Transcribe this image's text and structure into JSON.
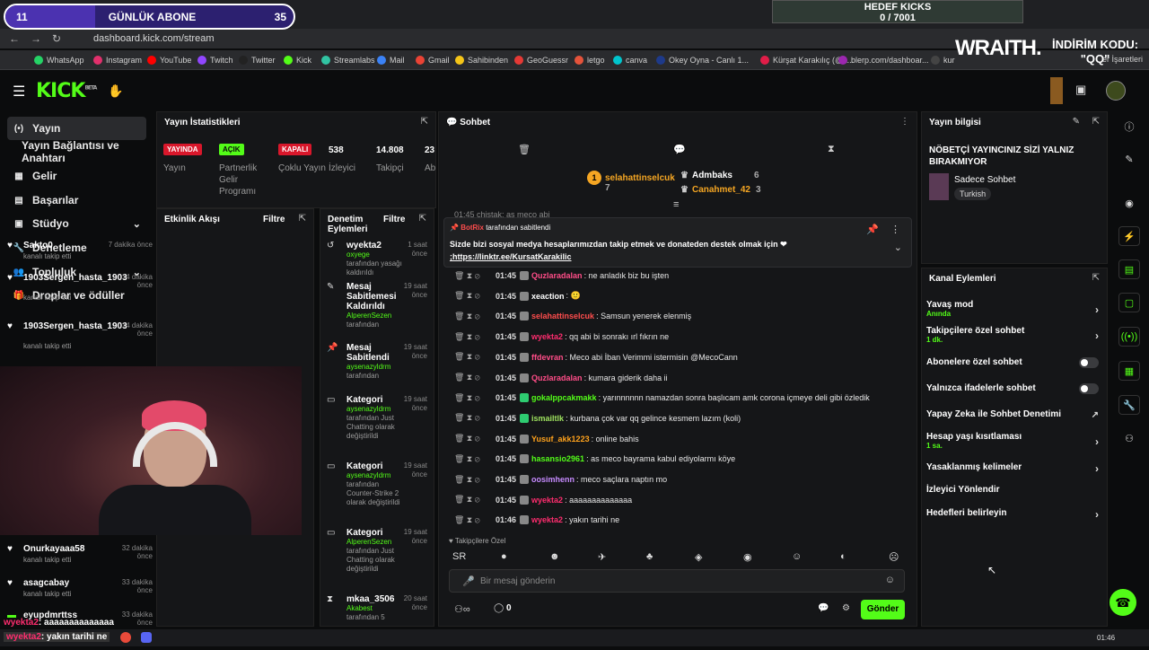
{
  "overlay": {
    "gunluk": {
      "left": "11",
      "title": "GÜNLÜK ABONE",
      "right": "35",
      "progress": 0.31
    },
    "hedef": {
      "title": "HEDEF KICKS",
      "value": "0 / 7001"
    },
    "wraith": "WRAITH.",
    "indirim_line1": "İNDİRİM KODU:",
    "indirim_line2": "\"QQ\""
  },
  "browser": {
    "url": "dashboard.kick.com/stream",
    "tab_text": "dashboard",
    "bookmarks": [
      "WhatsApp",
      "Instagram",
      "YouTube",
      "Twitch",
      "Twitter",
      "Kick",
      "Streamlabs",
      "Mail",
      "Gmail",
      "Sahibinden",
      "GeoGuessr",
      "letgo",
      "canva",
      "Okey Oyna - Canlı 1...",
      "Kürşat Karakılıç (@k...",
      "blerp.com/dashboar...",
      "kur"
    ],
    "bookmark_tail": "er İşaretleri",
    "bookmark_colors": [
      "#25d366",
      "#e1306c",
      "#ff0000",
      "#9146ff",
      "#222222",
      "#53fc18",
      "#31c3a2",
      "#3b82f6",
      "#ea4335",
      "#f5c518",
      "#e53935",
      "#e5533b",
      "#00c4cc",
      "#1e3a8a",
      "#e11d48",
      "#9c27b0",
      "#444444"
    ]
  },
  "kick": {
    "logo": "KICK",
    "beta": "BETA"
  },
  "sidebar": {
    "items": [
      {
        "label": "Yayın",
        "icon": "broadcast-icon",
        "glyph": "(•)"
      },
      {
        "label": "Yayın Bağlantısı ve Anahtarı",
        "icon": "",
        "glyph": ""
      },
      {
        "label": "Gelir",
        "icon": "revenue-icon",
        "glyph": "▦"
      },
      {
        "label": "Başarılar",
        "icon": "achievements-icon",
        "glyph": "▤"
      },
      {
        "label": "Stüdyo",
        "icon": "studio-icon",
        "glyph": "▣",
        "chevron": "⌄"
      },
      {
        "label": "Denetleme",
        "icon": "moderation-icon",
        "glyph": "🔧"
      },
      {
        "label": "Topluluk",
        "icon": "community-icon",
        "glyph": "👥",
        "chevron": "⌄"
      },
      {
        "label": "Droplar ve ödüller",
        "icon": "drops-icon",
        "glyph": "🎁"
      }
    ]
  },
  "stats_panel": {
    "title": "Yayın İstatistikleri",
    "items": [
      {
        "badge": "YAYINDA",
        "label": "Yayın",
        "color": "#d9172b",
        "fg": "#ffffff"
      },
      {
        "badge": "AÇIK",
        "label": "Partnerlik Gelir Programı",
        "color": "#53fc18",
        "fg": "#0b0c0d"
      },
      {
        "badge": "KAPALI",
        "label": "Çoklu Yayın",
        "color": "#d9172b",
        "fg": "#ffffff"
      },
      {
        "value": "538",
        "label": "İzleyici"
      },
      {
        "value": "14.808",
        "label": "Takipçi"
      },
      {
        "value": "23",
        "label": "Ab Sa"
      }
    ]
  },
  "activity": {
    "title": "Etkinlik Akışı",
    "filter": "Filtre",
    "items": [
      {
        "name": "Sakto0",
        "sub": "kanalı takip etti",
        "time": "7 dakika önce"
      },
      {
        "name": "1903Sergen_hasta_1903",
        "sub": "kanalı takip etti",
        "time": "14 dakika önce"
      },
      {
        "name": "1903Sergen_hasta_1903",
        "sub": "kanalı takip etti",
        "time": "14 dakika önce"
      },
      {
        "name": "Onurkayaaa58",
        "sub": "kanalı takip etti",
        "time": "32 dakika önce"
      },
      {
        "name": "asagcabay",
        "sub": "kanalı takip etti",
        "time": "33 dakika önce"
      },
      {
        "name": "eyupdmrttss",
        "sub": "",
        "time": "33 dakika önce"
      }
    ]
  },
  "moderation": {
    "title": "Denetim Eylemleri",
    "filter": "Filtre",
    "items": [
      {
        "name": "wyekta2",
        "time": "1 saat önce",
        "user": "oxyege",
        "rest": "tarafından yasağı kaldırıldı",
        "glyph": "↺"
      },
      {
        "name": "Mesaj Sabitlemesi Kaldırıldı",
        "time": "19 saat önce",
        "user": "AlperenSezen",
        "rest": "tarafından",
        "glyph": "✎"
      },
      {
        "name": "Mesaj Sabitlendi",
        "time": "19 saat önce",
        "user": "aysenazyldrm",
        "rest": "tarafından",
        "glyph": "📌"
      },
      {
        "name": "Kategori",
        "time": "19 saat önce",
        "user": "aysenazyldrm",
        "rest": "tarafından Just Chatting olarak değiştirildi",
        "glyph": "▭"
      },
      {
        "name": "Kategori",
        "time": "19 saat önce",
        "user": "aysenazyldrm",
        "rest": "tarafından Counter-Strike 2 olarak değiştirildi",
        "glyph": "▭"
      },
      {
        "name": "Kategori",
        "time": "19 saat önce",
        "user": "AlperenSezen",
        "rest": "tarafından Just Chatting olarak değiştirildi",
        "glyph": "▭"
      },
      {
        "name": "mkaa_3506",
        "time": "20 saat önce",
        "user": "Akabest",
        "rest": "tarafından 5",
        "glyph": "⧗"
      }
    ]
  },
  "chat": {
    "title": "Sohbet",
    "leaders": [
      {
        "name": "selahattinselcuk",
        "count": "7",
        "color": "#f5a623"
      },
      {
        "name": "Admbaks",
        "count": "6",
        "color": "#ffffff"
      },
      {
        "name": "Canahmet_42",
        "count": "3",
        "color": "#f5a623"
      }
    ],
    "partial_top": "01:45  chistak: as meco abi",
    "pinned": {
      "by": "BotRix",
      "by_suffix": "tarafından sabitlendi",
      "text": "Sizde bizi sosyal medya hesaplarımızdan takip etmek ve donateden destek olmak için ❤",
      "link": ";https://linktr.ee/KursatKarakilic"
    },
    "messages": [
      {
        "time": "01:45",
        "user": "Quzlaradalan",
        "color": "#ff4d88",
        "text": ": ne anladık biz bu işten"
      },
      {
        "time": "01:45",
        "user": "xeaction",
        "color": "#ffffff",
        "text": ":  🙂"
      },
      {
        "time": "01:45",
        "user": "selahattinselcuk",
        "color": "#ff4d4d",
        "text": ": Samsun yenerek elenmiş"
      },
      {
        "time": "01:45",
        "user": "wyekta2",
        "color": "#ff2d6f",
        "text": ": qq abi bi sonrakı ırl fıkrın ne"
      },
      {
        "time": "01:45",
        "user": "ffdevran",
        "color": "#ff4d88",
        "text": ": Meco abi İban Verimmi istermisin @MecoCann"
      },
      {
        "time": "01:45",
        "user": "Quzlaradalan",
        "color": "#ff4d88",
        "text": ": kumara giderik daha ii"
      },
      {
        "time": "01:45",
        "user": "gokalppcakmakk",
        "color": "#53fc18",
        "text": ": yarınnnnnn namazdan sonra başlıcam amk corona içmeye deli gibi özledik"
      },
      {
        "time": "01:45",
        "user": "ismailtlk",
        "color": "#9fe35f",
        "text": ": kurbana çok var qq gelince kesmem lazım (koli)"
      },
      {
        "time": "01:45",
        "user": "Yusuf_akk1223",
        "color": "#ffa21c",
        "text": ": online bahis"
      },
      {
        "time": "01:45",
        "user": "hasansio2961",
        "color": "#53fc18",
        "text": ": as meco bayrama kabul ediyolarmı köye"
      },
      {
        "time": "01:45",
        "user": "oosimhenn",
        "color": "#c78bff",
        "text": ": meco saçlara naptın mo"
      },
      {
        "time": "01:45",
        "user": "wyekta2",
        "color": "#ff2d6f",
        "text": ": aaaaaaaaaaaaaa"
      },
      {
        "time": "01:46",
        "user": "wyekta2",
        "color": "#ff2d6f",
        "text": ": yakın tarihi ne"
      }
    ],
    "follower_label": "Takipçilere Özel",
    "emotes": [
      "SR",
      "●",
      "☻",
      "✈",
      "♣",
      "◈",
      "◉",
      "☺",
      "◐",
      "☹"
    ],
    "input_placeholder": "Bir mesaj gönderin",
    "points": "0",
    "send": "Gönder"
  },
  "stream_info": {
    "title": "Yayın bilgisi",
    "stream_title": "NÖBETÇİ YAYINCINIZ SİZİ YALNIZ BIRAKMIYOR",
    "category": "Sadece Sohbet",
    "tag": "Turkish"
  },
  "channel_actions": {
    "title": "Kanal Eylemleri",
    "items": [
      {
        "label": "Yavaş mod",
        "sub": "Anında",
        "kind": "chevron"
      },
      {
        "label": "Takipçilere özel sohbet",
        "sub": "1 dk.",
        "kind": "chevron"
      },
      {
        "label": "Abonelere özel sohbet",
        "sub": "",
        "kind": "toggle"
      },
      {
        "label": "Yalnızca ifadelerle sohbet",
        "sub": "",
        "kind": "toggle"
      },
      {
        "label": "Yapay Zeka ile Sohbet Denetimi",
        "sub": "",
        "kind": "external"
      },
      {
        "label": "Hesap yaşı kısıtlaması",
        "sub": "1 sa.",
        "kind": "chevron"
      },
      {
        "label": "Yasaklanmış kelimeler",
        "sub": "",
        "kind": "chevron"
      },
      {
        "label": "İzleyici Yönlendir",
        "sub": "",
        "kind": "none"
      },
      {
        "label": "Hedefleri belirleyin",
        "sub": "",
        "kind": "chevron"
      }
    ]
  },
  "overlay_chat": {
    "user1": "wyekta2",
    "text1": ": aaaaaaaaaaaaaa",
    "user2": "wyekta2",
    "text2": ": yakın tarihi ne"
  },
  "taskbar": {
    "time": "01:46"
  }
}
